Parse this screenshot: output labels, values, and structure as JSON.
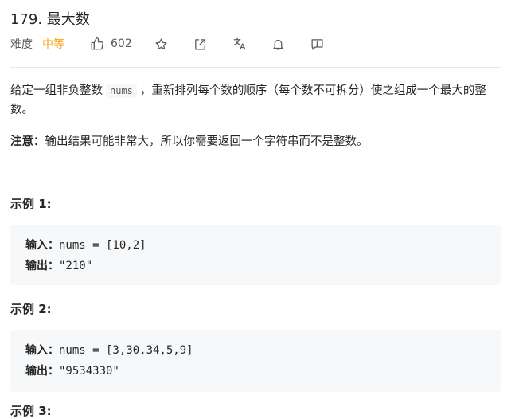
{
  "problem": {
    "title": "179. 最大数",
    "difficulty_label": "难度",
    "difficulty": "中等",
    "likes": "602"
  },
  "icons": [
    "thumbs-up-icon",
    "star-icon",
    "share-icon",
    "translate-icon",
    "bell-icon",
    "feedback-icon"
  ],
  "colors": {
    "difficulty": "#ffa116",
    "code_bg": "#f7f8fa"
  },
  "description": {
    "text_before": "给定一组非负整数",
    "code": "nums",
    "text_after": "，重新排列每个数的顺序（每个数不可拆分）使之组成一个最大的整数。",
    "note_label": "注意：",
    "note_text": "输出结果可能非常大，所以你需要返回一个字符串而不是整数。"
  },
  "examples": [
    {
      "title": "示例 1:",
      "input_label": "输入：",
      "input": "nums = [10,2]",
      "output_label": "输出：",
      "output": "\"210\""
    },
    {
      "title": "示例 2:",
      "input_label": "输入：",
      "input": "nums = [3,30,34,5,9]",
      "output_label": "输出：",
      "output": "\"9534330\""
    }
  ],
  "partial_heading": "示例 3:"
}
